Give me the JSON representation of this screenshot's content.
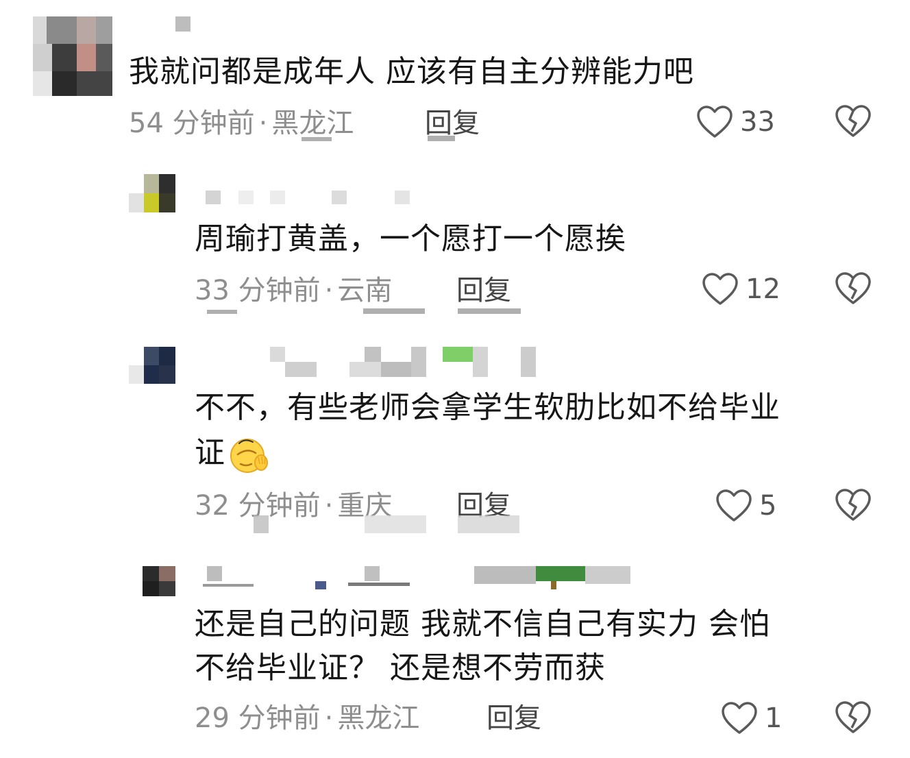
{
  "comments": [
    {
      "text": "我就问都是成年人  应该有自主分辨能力吧",
      "time": "54 分钟前",
      "dot": "·",
      "location": "黑龙江",
      "reply_label": "回复",
      "likes": "33"
    },
    {
      "text": "周瑜打黄盖，一个愿打一个愿挨",
      "time": "33 分钟前",
      "dot": "·",
      "location": "云南",
      "reply_label": "回复",
      "likes": "12"
    },
    {
      "text_line1": "不不，有些老师会拿学生软肋比如不给毕业",
      "text_line2": "证",
      "time": "32 分钟前",
      "dot": "·",
      "location": "重庆",
      "reply_label": "回复",
      "likes": "5"
    },
    {
      "text_line1": "还是自己的问题  我就不信自己有实力  会怕",
      "text_line2": "不给毕业证？  还是想不劳而获",
      "time": "29 分钟前",
      "dot": "·",
      "location": "黑龙江",
      "reply_label": "回复",
      "likes": "1"
    }
  ],
  "icons": {
    "like": "heart-outline-icon",
    "dislike": "broken-heart-icon",
    "emoji": "facepalm-emoji"
  },
  "colors": {
    "text": "#161616",
    "meta": "#8e8e8e",
    "icon_stroke": "#5a5a5a",
    "emoji_yellow": "#ffd54a"
  }
}
